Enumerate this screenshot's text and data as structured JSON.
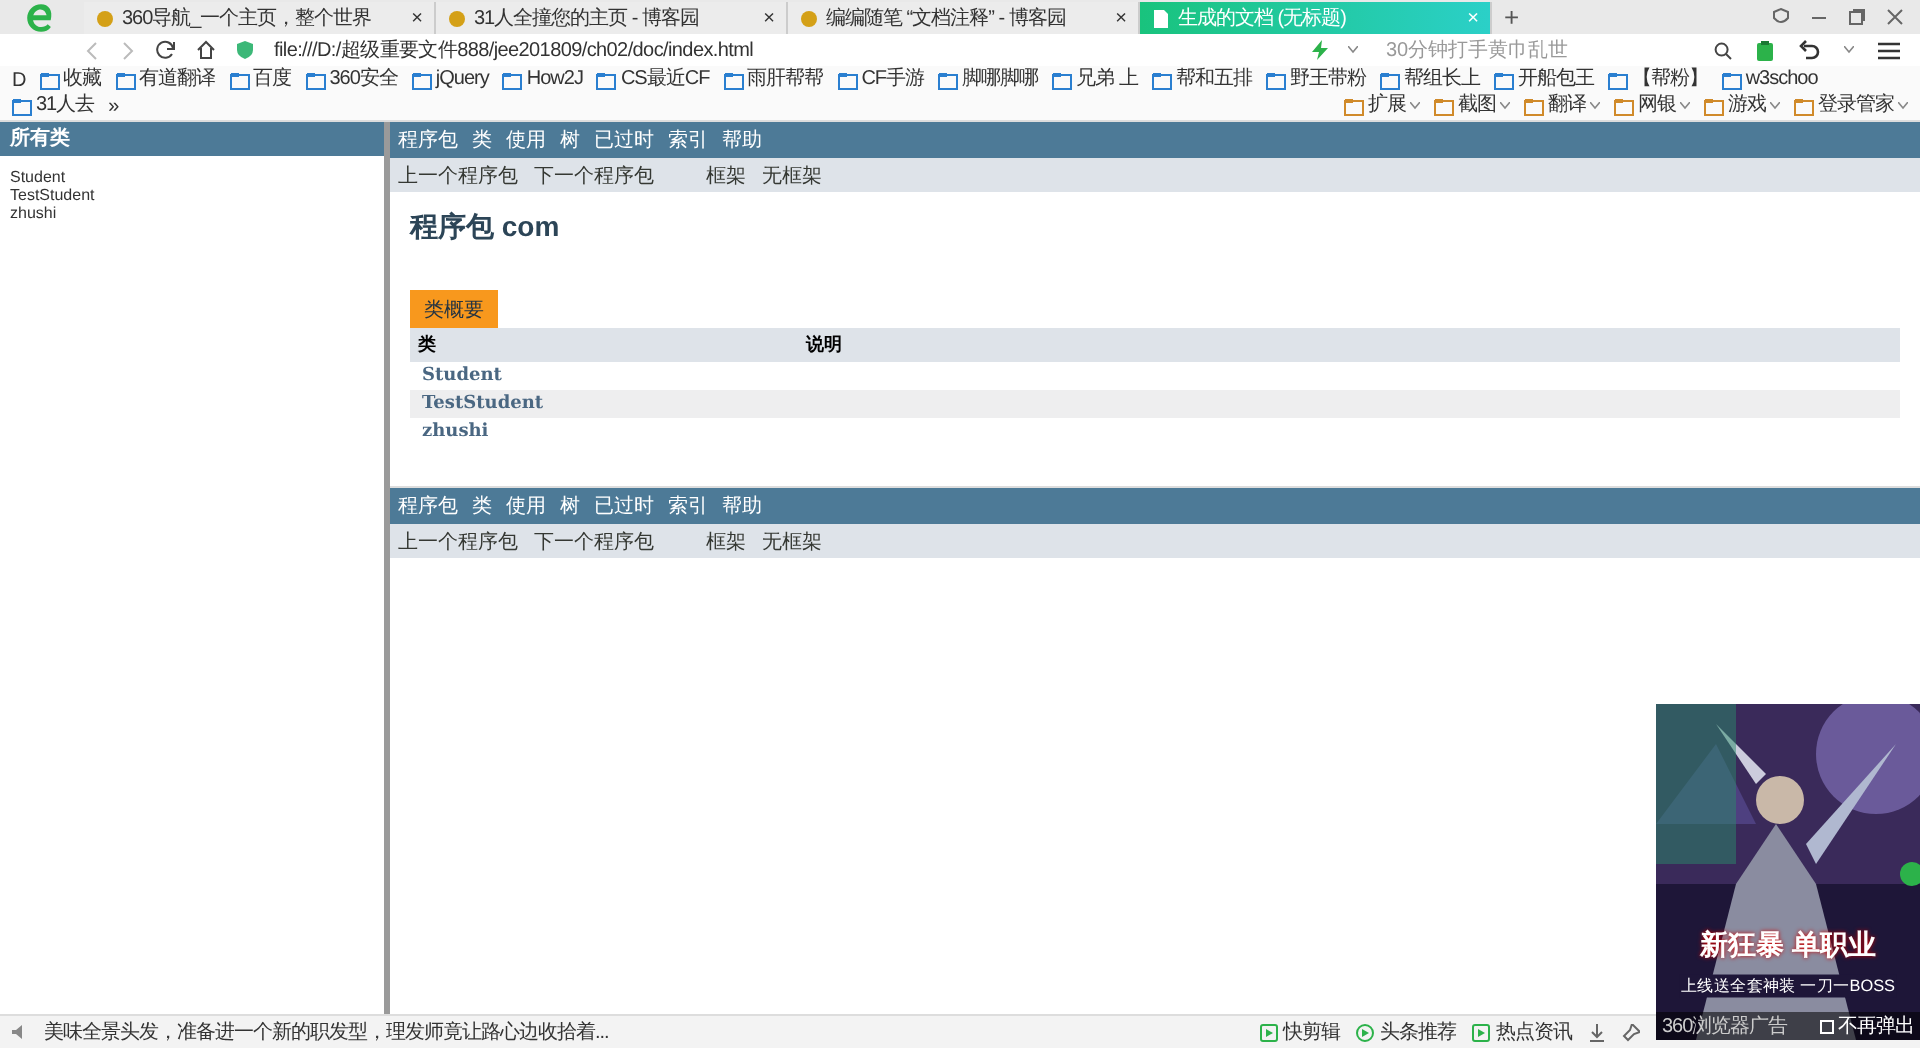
{
  "tabs": [
    {
      "label": "360导航_一个主页，整个世界",
      "close": "×",
      "selected": false
    },
    {
      "label": "31人全撞您的主页 - 博客园",
      "close": "×",
      "selected": false
    },
    {
      "label": "编编随笔 “文档注释” - 博客园",
      "close": "×",
      "selected": false
    },
    {
      "label": "生成的文档 (无标题)",
      "close": "×",
      "selected": true
    }
  ],
  "new_tab": "+",
  "address_bar": {
    "url": "file:///D:/超级重要文件888/jee201809/ch02/doc/index.html",
    "search_placeholder": "30分钟打手黄巾乱世"
  },
  "bookmarks_lead": "D",
  "bookmarks": [
    {
      "label": "收藏"
    },
    {
      "label": "有道翻译"
    },
    {
      "label": "百度"
    },
    {
      "label": "360安全"
    },
    {
      "label": "jQuery"
    },
    {
      "label": "How2J"
    },
    {
      "label": "CS最近CF"
    },
    {
      "label": "雨肝帮帮"
    },
    {
      "label": "CF手游"
    },
    {
      "label": "脚哪脚哪"
    },
    {
      "label": "兄弟 上"
    },
    {
      "label": "帮和五排"
    },
    {
      "label": "野王带粉"
    },
    {
      "label": "帮组长上"
    },
    {
      "label": "开船包王"
    },
    {
      "label": "【帮粉】"
    },
    {
      "label": "w3schoo"
    },
    {
      "label": "31人去"
    }
  ],
  "bookmarks_more": "»",
  "toolbar_right": [
    {
      "label": "扩展"
    },
    {
      "label": "截图"
    },
    {
      "label": "翻译"
    },
    {
      "label": "网银"
    },
    {
      "label": "游戏"
    },
    {
      "label": "登录管家"
    }
  ],
  "left_frame": {
    "title": "所有类",
    "items": [
      "Student",
      "TestStudent",
      "zhushi"
    ]
  },
  "doc": {
    "top_nav": [
      "程序包",
      "类",
      "使用",
      "树",
      "已过时",
      "索引",
      "帮助"
    ],
    "sub_nav": [
      "上一个程序包",
      "下一个程序包"
    ],
    "frame_links": [
      "框架",
      "无框架"
    ],
    "title": "程序包 com",
    "caption": "类概要",
    "columns": [
      "类",
      "说明"
    ],
    "rows": [
      "Student",
      "TestStudent",
      "zhushi"
    ],
    "bottom_nav": [
      "程序包",
      "类",
      "使用",
      "树",
      "已过时",
      "索引",
      "帮助"
    ],
    "bottom_sub_nav": [
      "上一个程序包",
      "下一个程序包"
    ],
    "bottom_frame_links": [
      "框架",
      "无框架"
    ]
  },
  "ad": {
    "headline": "新狂暴 单职业",
    "tagline": "上线送全套神装 一刀一BOSS",
    "source": "360浏览器广告",
    "dismiss": "不再弹出"
  },
  "status_bar": {
    "news": "美味全景头发，准备进一个新的职发型，理发师竟让路心边收拾着...",
    "items": [
      "快剪辑",
      "头条推荐",
      "热点资讯"
    ]
  }
}
